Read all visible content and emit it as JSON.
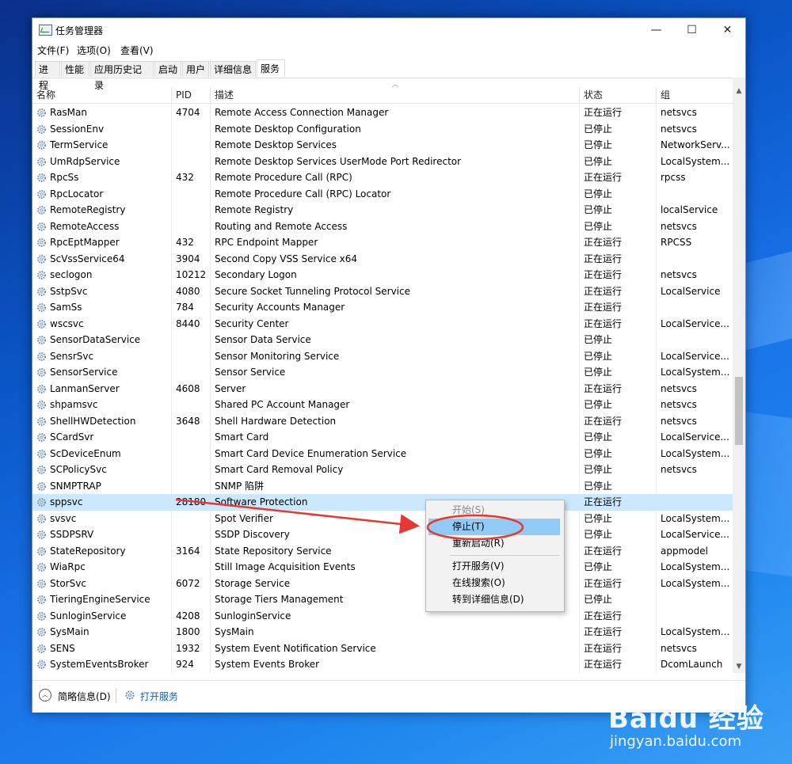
{
  "window": {
    "title": "任务管理器",
    "controls": {
      "minimize": "—",
      "maximize": "☐",
      "close": "✕"
    }
  },
  "menu": [
    "文件(F)",
    "选项(O)",
    "查看(V)"
  ],
  "tabs": [
    "进程",
    "性能",
    "应用历史记录",
    "启动",
    "用户",
    "详细信息",
    "服务"
  ],
  "active_tab": "服务",
  "table": {
    "columns": {
      "name": "名称",
      "pid": "PID",
      "desc": "描述",
      "status": "状态",
      "group": "组"
    },
    "rows": [
      {
        "name": "RasMan",
        "pid": "4704",
        "desc": "Remote Access Connection Manager",
        "status": "正在运行",
        "group": "netsvcs"
      },
      {
        "name": "SessionEnv",
        "pid": "",
        "desc": "Remote Desktop Configuration",
        "status": "已停止",
        "group": "netsvcs"
      },
      {
        "name": "TermService",
        "pid": "",
        "desc": "Remote Desktop Services",
        "status": "已停止",
        "group": "NetworkServ..."
      },
      {
        "name": "UmRdpService",
        "pid": "",
        "desc": "Remote Desktop Services UserMode Port Redirector",
        "status": "已停止",
        "group": "LocalSystem..."
      },
      {
        "name": "RpcSs",
        "pid": "432",
        "desc": "Remote Procedure Call (RPC)",
        "status": "正在运行",
        "group": "rpcss"
      },
      {
        "name": "RpcLocator",
        "pid": "",
        "desc": "Remote Procedure Call (RPC) Locator",
        "status": "已停止",
        "group": ""
      },
      {
        "name": "RemoteRegistry",
        "pid": "",
        "desc": "Remote Registry",
        "status": "已停止",
        "group": "localService"
      },
      {
        "name": "RemoteAccess",
        "pid": "",
        "desc": "Routing and Remote Access",
        "status": "已停止",
        "group": "netsvcs"
      },
      {
        "name": "RpcEptMapper",
        "pid": "432",
        "desc": "RPC Endpoint Mapper",
        "status": "正在运行",
        "group": "RPCSS"
      },
      {
        "name": "ScVssService64",
        "pid": "3904",
        "desc": "Second Copy VSS Service x64",
        "status": "正在运行",
        "group": ""
      },
      {
        "name": "seclogon",
        "pid": "10212",
        "desc": "Secondary Logon",
        "status": "正在运行",
        "group": "netsvcs"
      },
      {
        "name": "SstpSvc",
        "pid": "4080",
        "desc": "Secure Socket Tunneling Protocol Service",
        "status": "正在运行",
        "group": "LocalService"
      },
      {
        "name": "SamSs",
        "pid": "784",
        "desc": "Security Accounts Manager",
        "status": "正在运行",
        "group": ""
      },
      {
        "name": "wscsvc",
        "pid": "8440",
        "desc": "Security Center",
        "status": "正在运行",
        "group": "LocalService..."
      },
      {
        "name": "SensorDataService",
        "pid": "",
        "desc": "Sensor Data Service",
        "status": "已停止",
        "group": ""
      },
      {
        "name": "SensrSvc",
        "pid": "",
        "desc": "Sensor Monitoring Service",
        "status": "已停止",
        "group": "LocalService..."
      },
      {
        "name": "SensorService",
        "pid": "",
        "desc": "Sensor Service",
        "status": "已停止",
        "group": "LocalSystem..."
      },
      {
        "name": "LanmanServer",
        "pid": "4608",
        "desc": "Server",
        "status": "正在运行",
        "group": "netsvcs"
      },
      {
        "name": "shpamsvc",
        "pid": "",
        "desc": "Shared PC Account Manager",
        "status": "已停止",
        "group": "netsvcs"
      },
      {
        "name": "ShellHWDetection",
        "pid": "3648",
        "desc": "Shell Hardware Detection",
        "status": "正在运行",
        "group": "netsvcs"
      },
      {
        "name": "SCardSvr",
        "pid": "",
        "desc": "Smart Card",
        "status": "已停止",
        "group": "LocalService..."
      },
      {
        "name": "ScDeviceEnum",
        "pid": "",
        "desc": "Smart Card Device Enumeration Service",
        "status": "已停止",
        "group": "LocalSystem..."
      },
      {
        "name": "SCPolicySvc",
        "pid": "",
        "desc": "Smart Card Removal Policy",
        "status": "已停止",
        "group": "netsvcs"
      },
      {
        "name": "SNMPTRAP",
        "pid": "",
        "desc": "SNMP 陷阱",
        "status": "已停止",
        "group": ""
      },
      {
        "name": "sppsvc",
        "pid": "28180",
        "desc": "Software Protection",
        "status": "正在运行",
        "group": ""
      },
      {
        "name": "svsvc",
        "pid": "",
        "desc": "Spot Verifier",
        "status": "已停止",
        "group": "LocalSystem..."
      },
      {
        "name": "SSDPSRV",
        "pid": "",
        "desc": "SSDP Discovery",
        "status": "已停止",
        "group": "LocalService..."
      },
      {
        "name": "StateRepository",
        "pid": "3164",
        "desc": "State Repository Service",
        "status": "正在运行",
        "group": "appmodel"
      },
      {
        "name": "WiaRpc",
        "pid": "",
        "desc": "Still Image Acquisition Events",
        "status": "已停止",
        "group": "LocalSystem..."
      },
      {
        "name": "StorSvc",
        "pid": "6072",
        "desc": "Storage Service",
        "status": "正在运行",
        "group": "LocalSystem..."
      },
      {
        "name": "TieringEngineService",
        "pid": "",
        "desc": "Storage Tiers Management",
        "status": "已停止",
        "group": ""
      },
      {
        "name": "SunloginService",
        "pid": "4208",
        "desc": "SunloginService",
        "status": "正在运行",
        "group": ""
      },
      {
        "name": "SysMain",
        "pid": "1800",
        "desc": "SysMain",
        "status": "正在运行",
        "group": "LocalSystem..."
      },
      {
        "name": "SENS",
        "pid": "1932",
        "desc": "System Event Notification Service",
        "status": "正在运行",
        "group": "netsvcs"
      },
      {
        "name": "SystemEventsBroker",
        "pid": "924",
        "desc": "System Events Broker",
        "status": "正在运行",
        "group": "DcomLaunch"
      }
    ],
    "selected_row": "sppsvc"
  },
  "context_menu": {
    "items": [
      {
        "label": "开始(S)",
        "state": "disabled"
      },
      {
        "label": "停止(T)",
        "state": "hover"
      },
      {
        "label": "重新启动(R)",
        "state": "normal"
      },
      {
        "label": "打开服务(V)",
        "state": "normal"
      },
      {
        "label": "在线搜索(O)",
        "state": "normal"
      },
      {
        "label": "转到详细信息(D)",
        "state": "normal"
      }
    ]
  },
  "footer": {
    "less_details": "简略信息(D)",
    "open_services": "打开服务"
  },
  "watermark": {
    "logo": "Baidu 经验",
    "url": "jingyan.baidu.com"
  },
  "colors": {
    "selection": "#cce8ff",
    "menu_hover": "#91c9f7",
    "annotation": "#e53935",
    "link": "#0066cc"
  }
}
